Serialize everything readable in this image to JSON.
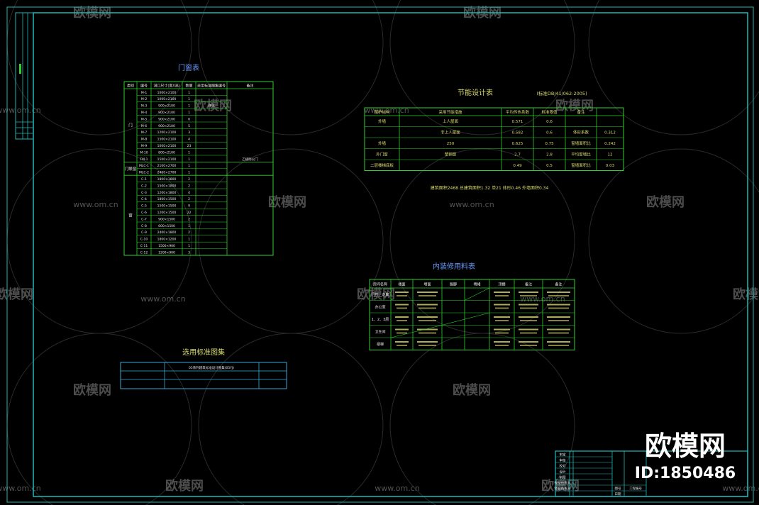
{
  "watermark": {
    "brand": "欧模网",
    "url": "www.om.cn",
    "url_short": "om.cn",
    "id_label": "ID:1850486"
  },
  "colors": {
    "background": "#000000",
    "frame": "#1fb9b9",
    "table_line": "#2fd02f",
    "title_text": "#6c9cff",
    "cell_text": "#d8d870",
    "white_text": "#e8e8e8",
    "watermark": "#8a8a8a"
  },
  "door_window_table": {
    "title": "门窗表",
    "headers": [
      "类别",
      "编号",
      "洞口尺寸(宽X高)",
      "数量",
      "采用标准图集编号",
      "备注"
    ],
    "groups": [
      {
        "label": "门",
        "rows": [
          [
            "M-1",
            "1000×2100",
            "1",
            "",
            ""
          ],
          [
            "M-2",
            "1000×2100",
            "1",
            "",
            ""
          ],
          [
            "M-3",
            "900×2100",
            "1",
            "详见",
            ""
          ],
          [
            "M-4",
            "900×2100",
            "1",
            "",
            ""
          ],
          [
            "M-5",
            "900×2100",
            "6",
            "",
            ""
          ],
          [
            "M-6",
            "900×2100",
            "5",
            "",
            ""
          ],
          [
            "M-7",
            "1200×2100",
            "3",
            "",
            ""
          ],
          [
            "M-8",
            "1500×2100",
            "4",
            "",
            ""
          ],
          [
            "M-9",
            "1000×2100",
            "23",
            "",
            ""
          ],
          [
            "M-10",
            "800×2100",
            "1",
            "",
            ""
          ],
          [
            "FM-1",
            "1500×2100",
            "1",
            "",
            "乙级防火门"
          ]
        ]
      },
      {
        "label": "门联窗",
        "rows": [
          [
            "MLC-1",
            "2100×2700",
            "1",
            "",
            ""
          ],
          [
            "MLC-2",
            "2400×2700",
            "1",
            "",
            ""
          ]
        ]
      },
      {
        "label": "窗",
        "rows": [
          [
            "C-1",
            "1800×1800",
            "2",
            "",
            ""
          ],
          [
            "C-2",
            "1500×1800",
            "2",
            "",
            ""
          ],
          [
            "C-3",
            "1200×1800",
            "4",
            "",
            ""
          ],
          [
            "C-4",
            "1800×1500",
            "2",
            "",
            ""
          ],
          [
            "C-5",
            "1500×1500",
            "9",
            "",
            ""
          ],
          [
            "C-6",
            "1200×1500",
            "22",
            "",
            ""
          ],
          [
            "C-7",
            "900×1500",
            "2",
            "",
            ""
          ],
          [
            "C-8",
            "600×1500",
            "1",
            "",
            ""
          ],
          [
            "C-9",
            "2400×1800",
            "2",
            "",
            ""
          ],
          [
            "C-10",
            "1800×1200",
            "1",
            "",
            ""
          ],
          [
            "C-11",
            "1500×900",
            "1",
            "",
            ""
          ],
          [
            "C-12",
            "1200×900",
            "3",
            "",
            ""
          ]
        ]
      }
    ]
  },
  "energy_table": {
    "title": "节能设计表",
    "standard": "(标准DBJ41/062-2005)",
    "headers": [
      "围护结构",
      "采用节能措施",
      "平均传热系数",
      "标准限值",
      "备注",
      ""
    ],
    "rows": [
      [
        "外墙",
        "上人屋面",
        "0.571",
        "0.6",
        "",
        ""
      ],
      [
        "",
        "非上人屋面",
        "0.582",
        "0.6",
        "体形系数",
        "0.312"
      ],
      [
        "外墙",
        "250",
        "0.625",
        "0.75",
        "窗墙面积比",
        "0.242"
      ],
      [
        "外门窗",
        "塑钢窗",
        "2.7",
        "2.8",
        "平均窗墙比",
        "12"
      ],
      [
        "二层楼梯底板",
        "",
        "0.49",
        "0.5",
        "窗墙面积比",
        "0.03"
      ]
    ],
    "footnote": "建筑面积2468  总建筑面积1.32  单21  体形0.46  外墙面积0.34"
  },
  "finishing_table": {
    "title": "内装修用料表",
    "headers": [
      "房间名称",
      "楼面",
      "墙面",
      "踢脚",
      "墙裙",
      "顶棚",
      "备注",
      "备注"
    ],
    "rows": [
      [
        "门厅、走廊",
        "",
        "",
        "",
        "",
        "",
        "",
        ""
      ],
      [
        "办公室",
        "",
        "",
        "",
        "",
        "",
        "",
        ""
      ],
      [
        "1、2、3层",
        "",
        "",
        "",
        "",
        "",
        "",
        ""
      ],
      [
        "卫生间",
        "",
        "",
        "",
        "",
        "",
        "",
        ""
      ],
      [
        "楼梯",
        "",
        "",
        "",
        "",
        "",
        "",
        ""
      ]
    ]
  },
  "standard_atlas": {
    "title": "选用标准图集",
    "rows": [
      "05系列建筑标准设计图集(05YJ)"
    ]
  },
  "title_block": {
    "rows": [
      "审定",
      "审核",
      "校对",
      "设计",
      "制图",
      "专业负责人",
      "项目负责人"
    ],
    "bottom": [
      "图号",
      "日期",
      "工程编号"
    ]
  }
}
